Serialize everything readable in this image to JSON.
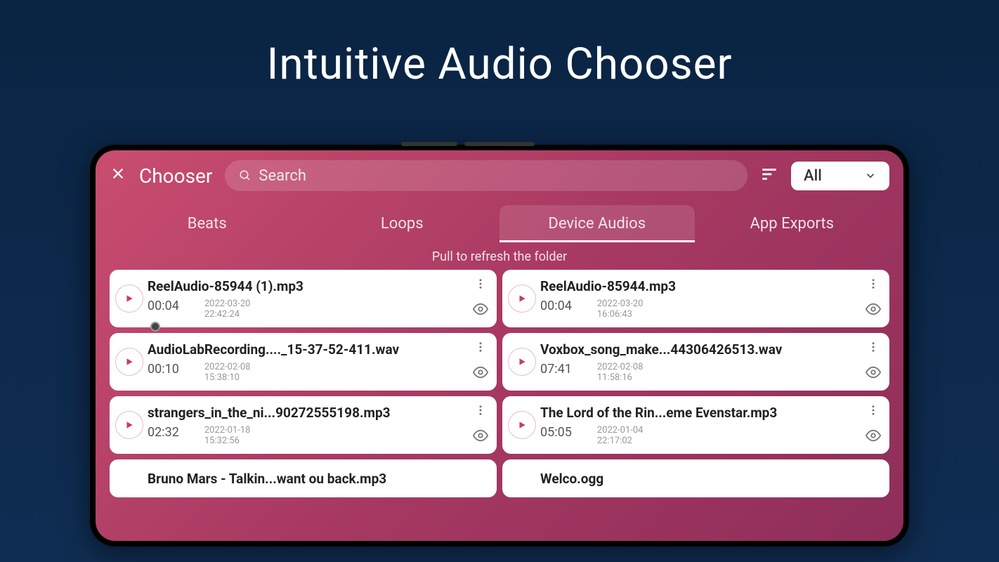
{
  "pageTitle": "Intuitive Audio Chooser",
  "topBar": {
    "title": "Chooser",
    "searchPlaceholder": "Search",
    "dropdownValue": "All"
  },
  "tabs": [
    {
      "label": "Beats",
      "active": false
    },
    {
      "label": "Loops",
      "active": false
    },
    {
      "label": "Device Audios",
      "active": true
    },
    {
      "label": "App Exports",
      "active": false
    }
  ],
  "pullText": "Pull to refresh the folder",
  "cards": [
    {
      "filename": "ReelAudio-85944 (1).mp3",
      "duration": "00:04",
      "date": "2022-03-20",
      "time": "22:42:24",
      "hasProgress": true
    },
    {
      "filename": "ReelAudio-85944.mp3",
      "duration": "00:04",
      "date": "2022-03-20",
      "time": "16:06:43",
      "hasProgress": false
    },
    {
      "filename": "AudioLabRecording...._15-37-52-411.wav",
      "duration": "00:10",
      "date": "2022-02-08",
      "time": "15:38:10",
      "hasProgress": false
    },
    {
      "filename": "Voxbox_song_make...44306426513.wav",
      "duration": "07:41",
      "date": "2022-02-08",
      "time": "11:58:16",
      "hasProgress": false
    },
    {
      "filename": "strangers_in_the_ni...90272555198.mp3",
      "duration": "02:32",
      "date": "2022-01-18",
      "time": "15:32:56",
      "hasProgress": false
    },
    {
      "filename": "The Lord of the Rin...eme Evenstar.mp3",
      "duration": "05:05",
      "date": "2022-01-04",
      "time": "22:17:02",
      "hasProgress": false
    },
    {
      "filename": "Bruno Mars - Talkin...want ou back.mp3",
      "partial": true
    },
    {
      "filename": "Welco.ogg",
      "partial": true
    }
  ]
}
